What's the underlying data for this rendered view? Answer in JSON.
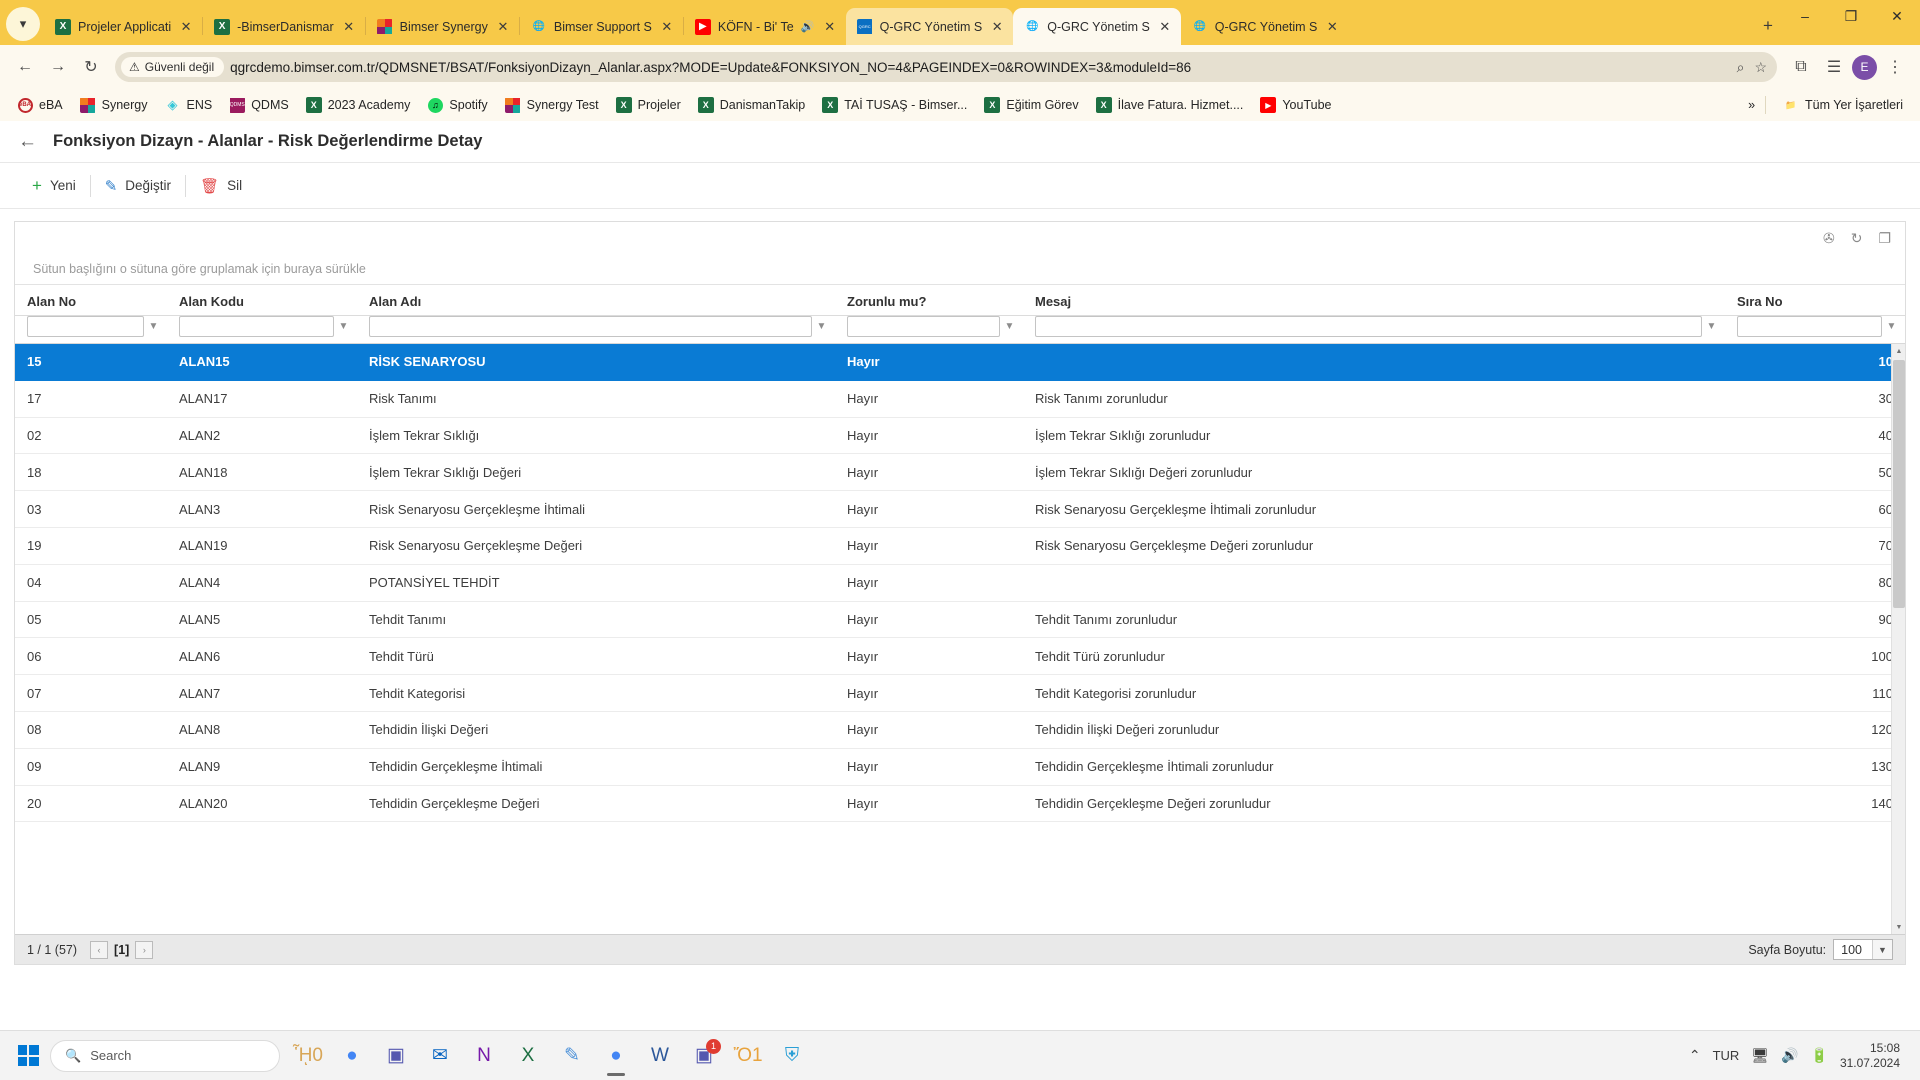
{
  "browser": {
    "tab_list_icon": "chevron-down-icon",
    "tabs": [
      {
        "title": "Projeler Applicati",
        "favicon": "excel-icon",
        "state": "inactive",
        "close": "✕"
      },
      {
        "title": "-BimserDanismar",
        "favicon": "excel-icon",
        "state": "inactive",
        "close": "✕"
      },
      {
        "title": "Bimser Synergy",
        "favicon": "synergy-icon",
        "state": "inactive",
        "close": "✕"
      },
      {
        "title": "Bimser Support S",
        "favicon": "globe-icon",
        "state": "inactive",
        "close": "✕"
      },
      {
        "title": "KÖFN - Bi' Te",
        "favicon": "youtube-icon",
        "state": "inactive",
        "audio": "ὐA",
        "close": "✕"
      },
      {
        "title": "Q-GRC Yönetim S",
        "favicon": "qgrc-icon",
        "state": "semi",
        "close": "✕"
      },
      {
        "title": "Q-GRC Yönetim S",
        "favicon": "globe-icon",
        "state": "active",
        "close": "✕"
      },
      {
        "title": "Q-GRC Yönetim S",
        "favicon": "globe-icon",
        "state": "inactive",
        "close": "✕"
      }
    ],
    "new_tab_label": "+",
    "window_controls": {
      "minimize": "–",
      "maximize": "❐",
      "close": "✕"
    },
    "nav": {
      "back": "←",
      "forward": "→",
      "reload": "↻"
    },
    "security_label": "Güvenli değil",
    "security_icon": "warning-triangle-icon",
    "url": "qgrcdemo.bimser.com.tr/QDMSNET/BSAT/FonksiyonDizayn_Alanlar.aspx?MODE=Update&FONKSIYON_NO=4&PAGEINDEX=0&ROWINDEX=3&moduleId=86",
    "omnibox_icons": {
      "zoom": "⌕",
      "bookmark": "☆"
    },
    "toolbar_icons": {
      "extensions": "⧉",
      "reading_list": "☰",
      "menu": "⋮"
    },
    "profile_initial": "E",
    "bookmarks": [
      {
        "label": "eBA",
        "icon": "eba-icon"
      },
      {
        "label": "Synergy",
        "icon": "synergy-icon"
      },
      {
        "label": "ENS",
        "icon": "ens-icon"
      },
      {
        "label": "QDMS",
        "icon": "qdms-icon"
      },
      {
        "label": "2023 Academy",
        "icon": "excel-icon"
      },
      {
        "label": "Spotify",
        "icon": "spotify-icon"
      },
      {
        "label": "Synergy Test",
        "icon": "synergy-icon"
      },
      {
        "label": "Projeler",
        "icon": "excel-icon"
      },
      {
        "label": "DanismanTakip",
        "icon": "excel-icon"
      },
      {
        "label": "TAİ TUSAŞ - Bimser...",
        "icon": "excel-icon"
      },
      {
        "label": "Eğitim Görev",
        "icon": "excel-icon"
      },
      {
        "label": "İlave Fatura. Hizmet....",
        "icon": "excel-icon"
      },
      {
        "label": "YouTube",
        "icon": "youtube-icon"
      }
    ],
    "bookmarks_overflow": "»",
    "all_bookmarks_label": "Tüm Yer İşaretleri",
    "all_bookmarks_icon": "folder-icon"
  },
  "app": {
    "back_icon": "arrow-left-icon",
    "title": "Fonksiyon Dizayn - Alanlar - Risk Değerlendirme Detay",
    "toolbar": [
      {
        "label": "Yeni",
        "icon": "plus-icon"
      },
      {
        "label": "Değiştir",
        "icon": "pencil-icon"
      },
      {
        "label": "Sil",
        "icon": "trash-icon"
      }
    ],
    "grid_tools": [
      {
        "name": "clear-filter-icon",
        "glyph": "✇"
      },
      {
        "name": "refresh-icon",
        "glyph": "↻"
      },
      {
        "name": "export-icon",
        "glyph": "❐"
      }
    ],
    "group_panel_text": "Sütun başlığını o sütuna göre gruplamak için buraya sürükle",
    "columns": [
      {
        "key": "alan_no",
        "label": "Alan No",
        "filter_value": "",
        "has_filter": true
      },
      {
        "key": "alan_kodu",
        "label": "Alan Kodu",
        "filter_value": "",
        "has_filter": true
      },
      {
        "key": "alan_adi",
        "label": "Alan Adı",
        "filter_value": "",
        "has_filter": true
      },
      {
        "key": "zorunlu",
        "label": "Zorunlu mu?",
        "filter_value": "",
        "has_filter": true
      },
      {
        "key": "mesaj",
        "label": "Mesaj",
        "filter_value": "",
        "has_filter": true
      },
      {
        "key": "sira_no",
        "label": "Sıra No",
        "filter_value": "",
        "has_filter": true
      }
    ],
    "rows": [
      {
        "alan_no": "15",
        "alan_kodu": "ALAN15",
        "alan_adi": "RİSK SENARYOSU",
        "zorunlu": "Hayır",
        "mesaj": "",
        "sira_no": "10",
        "selected": true
      },
      {
        "alan_no": "17",
        "alan_kodu": "ALAN17",
        "alan_adi": "Risk Tanımı",
        "zorunlu": "Hayır",
        "mesaj": "Risk Tanımı zorunludur",
        "sira_no": "30",
        "selected": false
      },
      {
        "alan_no": "02",
        "alan_kodu": "ALAN2",
        "alan_adi": "İşlem Tekrar Sıklığı",
        "zorunlu": "Hayır",
        "mesaj": "İşlem Tekrar Sıklığı zorunludur",
        "sira_no": "40",
        "selected": false
      },
      {
        "alan_no": "18",
        "alan_kodu": "ALAN18",
        "alan_adi": "İşlem Tekrar Sıklığı Değeri",
        "zorunlu": "Hayır",
        "mesaj": "İşlem Tekrar Sıklığı Değeri zorunludur",
        "sira_no": "50",
        "selected": false
      },
      {
        "alan_no": "03",
        "alan_kodu": "ALAN3",
        "alan_adi": "Risk Senaryosu Gerçekleşme İhtimali",
        "zorunlu": "Hayır",
        "mesaj": "Risk Senaryosu Gerçekleşme İhtimali zorunludur",
        "sira_no": "60",
        "selected": false
      },
      {
        "alan_no": "19",
        "alan_kodu": "ALAN19",
        "alan_adi": "Risk Senaryosu Gerçekleşme Değeri",
        "zorunlu": "Hayır",
        "mesaj": "Risk Senaryosu Gerçekleşme Değeri zorunludur",
        "sira_no": "70",
        "selected": false
      },
      {
        "alan_no": "04",
        "alan_kodu": "ALAN4",
        "alan_adi": "POTANSİYEL TEHDİT",
        "zorunlu": "Hayır",
        "mesaj": "",
        "sira_no": "80",
        "selected": false
      },
      {
        "alan_no": "05",
        "alan_kodu": "ALAN5",
        "alan_adi": "Tehdit Tanımı",
        "zorunlu": "Hayır",
        "mesaj": "Tehdit Tanımı zorunludur",
        "sira_no": "90",
        "selected": false
      },
      {
        "alan_no": "06",
        "alan_kodu": "ALAN6",
        "alan_adi": "Tehdit Türü",
        "zorunlu": "Hayır",
        "mesaj": "Tehdit Türü zorunludur",
        "sira_no": "100",
        "selected": false
      },
      {
        "alan_no": "07",
        "alan_kodu": "ALAN7",
        "alan_adi": "Tehdit Kategorisi",
        "zorunlu": "Hayır",
        "mesaj": "Tehdit Kategorisi zorunludur",
        "sira_no": "110",
        "selected": false
      },
      {
        "alan_no": "08",
        "alan_kodu": "ALAN8",
        "alan_adi": "Tehdidin İlişki Değeri",
        "zorunlu": "Hayır",
        "mesaj": "Tehdidin İlişki Değeri zorunludur",
        "sira_no": "120",
        "selected": false
      },
      {
        "alan_no": "09",
        "alan_kodu": "ALAN9",
        "alan_adi": "Tehdidin Gerçekleşme İhtimali",
        "zorunlu": "Hayır",
        "mesaj": "Tehdidin Gerçekleşme İhtimali zorunludur",
        "sira_no": "130",
        "selected": false
      },
      {
        "alan_no": "20",
        "alan_kodu": "ALAN20",
        "alan_adi": "Tehdidin Gerçekleşme Değeri",
        "zorunlu": "Hayır",
        "mesaj": "Tehdidin Gerçekleşme Değeri zorunludur",
        "sira_no": "140",
        "selected": false
      }
    ],
    "footer": {
      "page_info": "1 / 1 (57)",
      "prev": "‹",
      "current_page": "[1]",
      "next": "›",
      "page_size_label": "Sayfa Boyutu:",
      "page_size_value": "100"
    },
    "accent_color": "#0a7bd4"
  },
  "taskbar": {
    "start_icon": "windows-icon",
    "search_placeholder": "Search",
    "search_icon": "search-icon",
    "apps": [
      {
        "name": "widgets-icon",
        "glyph": "ᾟ0"
      },
      {
        "name": "chrome-icon",
        "glyph": "●"
      },
      {
        "name": "teams-icon",
        "glyph": "▣"
      },
      {
        "name": "outlook-icon",
        "glyph": "✉"
      },
      {
        "name": "onenote-icon",
        "glyph": "N"
      },
      {
        "name": "excel-icon",
        "glyph": "X"
      },
      {
        "name": "notepad-icon",
        "glyph": "✎"
      },
      {
        "name": "chrome-active-icon",
        "glyph": "●"
      },
      {
        "name": "word-icon",
        "glyph": "W"
      },
      {
        "name": "teams-badge-icon",
        "glyph": "▣",
        "badge": "1"
      },
      {
        "name": "file-explorer-icon",
        "glyph": "Ὄ1"
      },
      {
        "name": "qdms-app-icon",
        "glyph": "⛨"
      }
    ],
    "tray": {
      "chevron": "⌃",
      "language": "TUR",
      "network_icon": "὚7",
      "volume_icon": "ὐA",
      "battery_icon": "ὐB",
      "time": "15:08",
      "date": "31.07.2024"
    }
  }
}
